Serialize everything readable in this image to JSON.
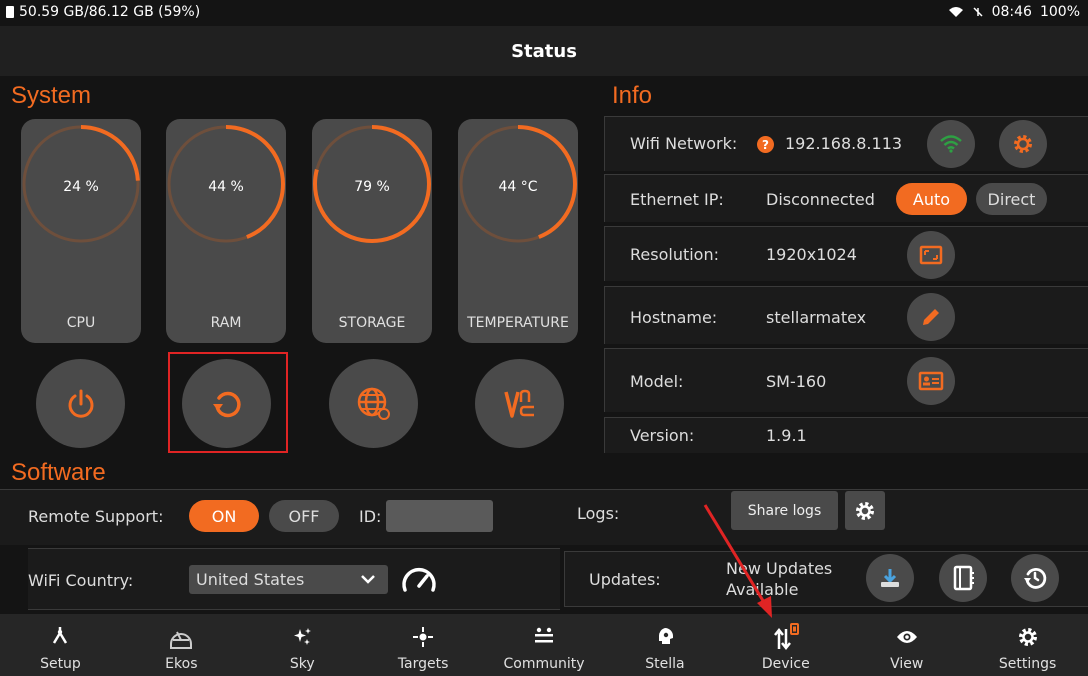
{
  "statusbar": {
    "storage": "50.59 GB/86.12 GB (59%)",
    "time": "08:46",
    "battery": "100%"
  },
  "header": {
    "title": "Status"
  },
  "system": {
    "title": "System",
    "gauges": [
      {
        "label": "CPU",
        "value_text": "24 %",
        "fraction": 0.24
      },
      {
        "label": "RAM",
        "value_text": "44 %",
        "fraction": 0.44
      },
      {
        "label": "STORAGE",
        "value_text": "79 %",
        "fraction": 0.79
      },
      {
        "label": "TEMPERATURE",
        "value_text": "44 °C",
        "fraction": 0.44
      }
    ],
    "actions": [
      "power-icon",
      "restart-icon",
      "web-icon",
      "vnc-icon"
    ]
  },
  "info": {
    "title": "Info",
    "wifi": {
      "label": "Wifi Network:",
      "value": "192.168.8.113"
    },
    "ethernet": {
      "label": "Ethernet IP:",
      "value": "Disconnected",
      "auto_label": "Auto",
      "direct_label": "Direct"
    },
    "resolution": {
      "label": "Resolution:",
      "value": "1920x1024"
    },
    "hostname": {
      "label": "Hostname:",
      "value": "stellarmatex"
    },
    "model": {
      "label": "Model:",
      "value": "SM-160"
    },
    "version": {
      "label": "Version:",
      "value": "1.9.1"
    }
  },
  "software": {
    "title": "Software",
    "remote_support": {
      "label": "Remote Support:",
      "on_label": "ON",
      "off_label": "OFF",
      "id_label": "ID:"
    },
    "logs": {
      "label": "Logs:",
      "share_label": "Share logs"
    },
    "wifi_country": {
      "label": "WiFi Country:",
      "selected": "United States"
    },
    "updates": {
      "label": "Updates:",
      "status_line1": "New Updates",
      "status_line2": "Available"
    }
  },
  "nav": [
    {
      "label": "Setup",
      "icon": "setup-icon"
    },
    {
      "label": "Ekos",
      "icon": "ekos-icon"
    },
    {
      "label": "Sky",
      "icon": "sky-icon"
    },
    {
      "label": "Targets",
      "icon": "targets-icon"
    },
    {
      "label": "Community",
      "icon": "community-icon"
    },
    {
      "label": "Stella",
      "icon": "stella-icon"
    },
    {
      "label": "Device",
      "icon": "device-icon"
    },
    {
      "label": "View",
      "icon": "view-icon"
    },
    {
      "label": "Settings",
      "icon": "settings-icon"
    }
  ],
  "colors": {
    "accent": "#f26b21",
    "card": "#4a4a4a",
    "annotation": "#e02424"
  }
}
